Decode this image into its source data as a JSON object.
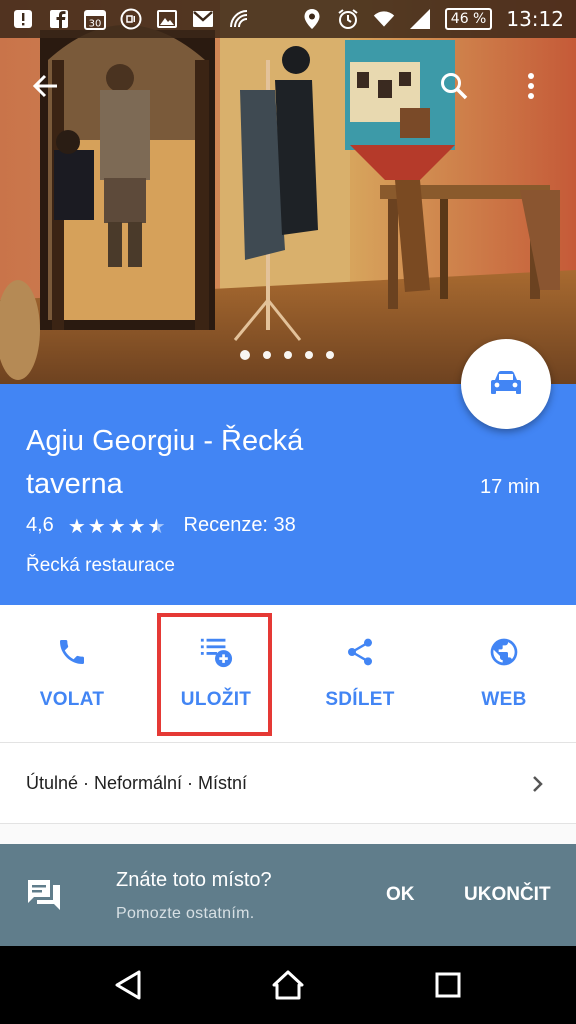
{
  "status_bar": {
    "icons": [
      "alert-icon",
      "facebook-icon",
      "calendar-icon",
      "mi-icon",
      "image-icon",
      "gmail-icon",
      "nfc-icon",
      "location-icon",
      "alarm-icon",
      "wifi-icon",
      "signal-icon"
    ],
    "calendar_day": "30",
    "battery": "46 %",
    "time": "13:12"
  },
  "app_bar": {
    "icons": [
      "back-arrow-icon",
      "search-icon",
      "more-vert-icon"
    ]
  },
  "photo": {
    "page_count": 5,
    "active_index": 0
  },
  "place": {
    "name": "Agiu Georgiu - Řecká taverna",
    "drive_time": "17 min",
    "rating": "4,6",
    "rating_value": 4.6,
    "stars_max": 5,
    "reviews": "Recenze: 38",
    "category": "Řecká restaurace"
  },
  "directions_fab": {
    "icon": "car-icon"
  },
  "actions": [
    {
      "label": "VOLAT",
      "icon": "phone-icon"
    },
    {
      "label": "ULOŽIT",
      "icon": "playlist-add-icon"
    },
    {
      "label": "SDÍLET",
      "icon": "share-icon"
    },
    {
      "label": "WEB",
      "icon": "globe-icon"
    }
  ],
  "tags": {
    "text": "Útulné · Neformální · Místní",
    "icon": "chevron-right-icon"
  },
  "snackbar": {
    "icon": "feedback-icon",
    "title": "Znáte toto místo?",
    "subtitle": "Pomozte ostatním.",
    "ok": "OK",
    "dismiss": "UKONČIT"
  },
  "colors": {
    "primary": "#4285f4",
    "snackbar": "#607d8b",
    "highlight": "#e53935"
  },
  "navbar": {
    "icons": [
      "back-icon",
      "home-icon",
      "recents-icon"
    ]
  }
}
